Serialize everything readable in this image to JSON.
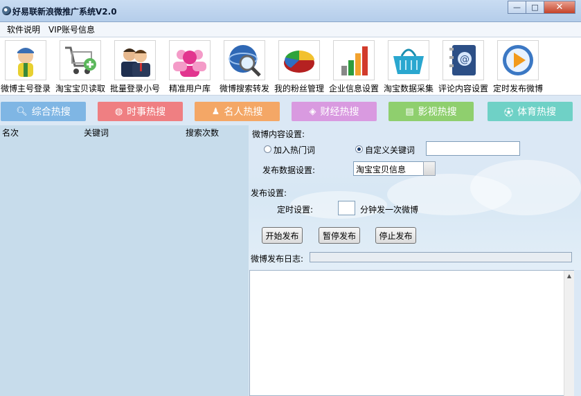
{
  "window": {
    "title": "好易联新浪微推广系统V2.0",
    "min": "—",
    "max": "□",
    "close": "✕"
  },
  "menu": [
    "软件说明",
    "VIP账号信息"
  ],
  "toolbar": [
    {
      "label": "微博主号登录",
      "icon": "user-icon"
    },
    {
      "label": "淘宝宝贝读取",
      "icon": "cart-add-icon"
    },
    {
      "label": "批量登录小号",
      "icon": "users-icon"
    },
    {
      "label": "精准用户库",
      "icon": "user-group-icon"
    },
    {
      "label": "微博搜索转发",
      "icon": "globe-search-icon"
    },
    {
      "label": "我的粉丝管理",
      "icon": "pie-chart-icon"
    },
    {
      "label": "企业信息设置",
      "icon": "bar-chart-icon"
    },
    {
      "label": "淘宝数据采集",
      "icon": "basket-icon"
    },
    {
      "label": "评论内容设置",
      "icon": "address-book-icon"
    },
    {
      "label": "定时发布微博",
      "icon": "play-icon"
    }
  ],
  "tabs": [
    {
      "label": "综合热搜",
      "icon": "search-icon",
      "color": "#7fb6e4"
    },
    {
      "label": "时事热搜",
      "icon": "globe-icon",
      "color": "#ef7f82"
    },
    {
      "label": "名人热搜",
      "icon": "person-icon",
      "color": "#f4a766"
    },
    {
      "label": "财经热搜",
      "icon": "tag-icon",
      "color": "#d99ae0"
    },
    {
      "label": "影视热搜",
      "icon": "film-icon",
      "color": "#8fcf6e"
    },
    {
      "label": "体育热搜",
      "icon": "ball-icon",
      "color": "#6fd1c6"
    }
  ],
  "table": {
    "columns": [
      "名次",
      "关键词",
      "搜索次数"
    ]
  },
  "settings": {
    "content_title": "微博内容设置:",
    "radio_hot": "加入热门词",
    "radio_custom": "自定义关键词",
    "custom_value": "",
    "publish_data_label": "发布数据设置:",
    "publish_data_value": "淘宝宝贝信息",
    "publish_title": "发布设置:",
    "timer_label": "定时设置:",
    "timer_value": "",
    "timer_suffix": "分钟发一次微博",
    "start": "开始发布",
    "pause": "暂停发布",
    "stop": "停止发布",
    "log_label": "微博发布日志:"
  }
}
